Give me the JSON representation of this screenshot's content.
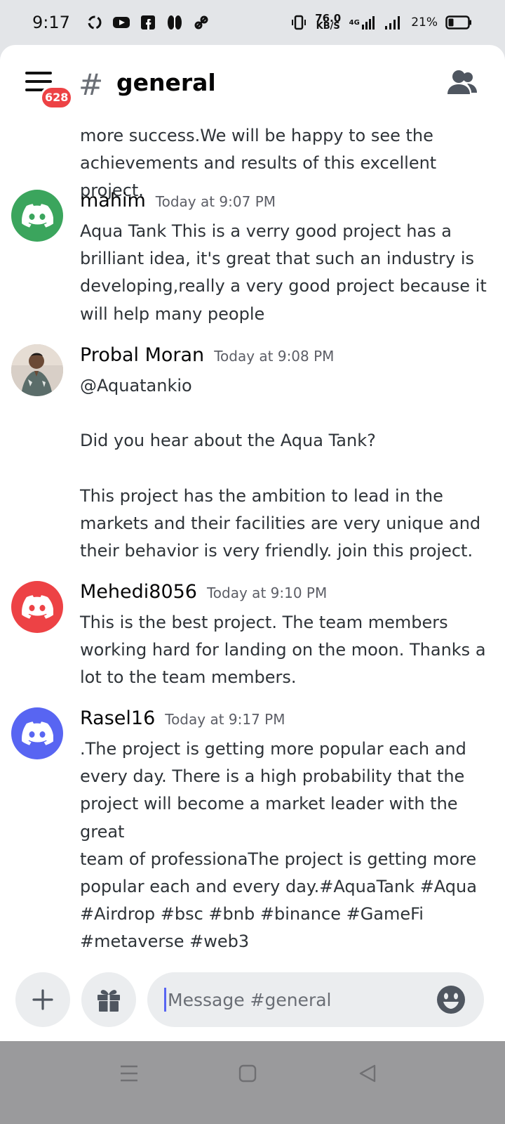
{
  "status_bar": {
    "time": "9:17",
    "speed_value": "76.0",
    "speed_unit": "KB/S",
    "network": "4G",
    "battery": "21%"
  },
  "header": {
    "badge_count": "628",
    "channel_name": "general"
  },
  "messages": {
    "continuation_text": "more success.We will be happy to see the\nachievements and results of this excellent project.",
    "items": [
      {
        "username": "mahim",
        "timestamp": "Today at 9:07 PM",
        "avatar_color": "#3ba55d",
        "text": "Aqua Tank This is a verry good project has a\nbrilliant idea, it's great that such an industry is\ndeveloping,really a very good project because it\nwill help many people"
      },
      {
        "username": "Probal Moran",
        "timestamp": "Today at 9:08 PM",
        "avatar_color": "photo",
        "text": "@Aquatankio\n\nDid you hear about the Aqua Tank?\n\nThis project has the ambition to lead in the\nmarkets and their facilities are very unique and\ntheir behavior is very friendly. join this project."
      },
      {
        "username": "Mehedi8056",
        "timestamp": "Today at 9:10 PM",
        "avatar_color": "#ed4245",
        "text": "This is the best project. The team members\nworking hard for landing on the moon. Thanks a\nlot to the team members."
      },
      {
        "username": "Rasel16",
        "timestamp": "Today at 9:17 PM",
        "avatar_color": "#5865f2",
        "text": ".The project is getting more popular each and\nevery day. There is a high probability that the\nproject will become a market leader with the great\nteam of professionaThe project is getting more\npopular each and every day.#AquaTank #Aqua\n#Airdrop #bsc #bnb #binance #GameFi\n#metaverse #web3"
      }
    ]
  },
  "composer": {
    "placeholder": "Message #general"
  },
  "colors": {
    "accent": "#5865f2",
    "badge": "#ed4245"
  }
}
